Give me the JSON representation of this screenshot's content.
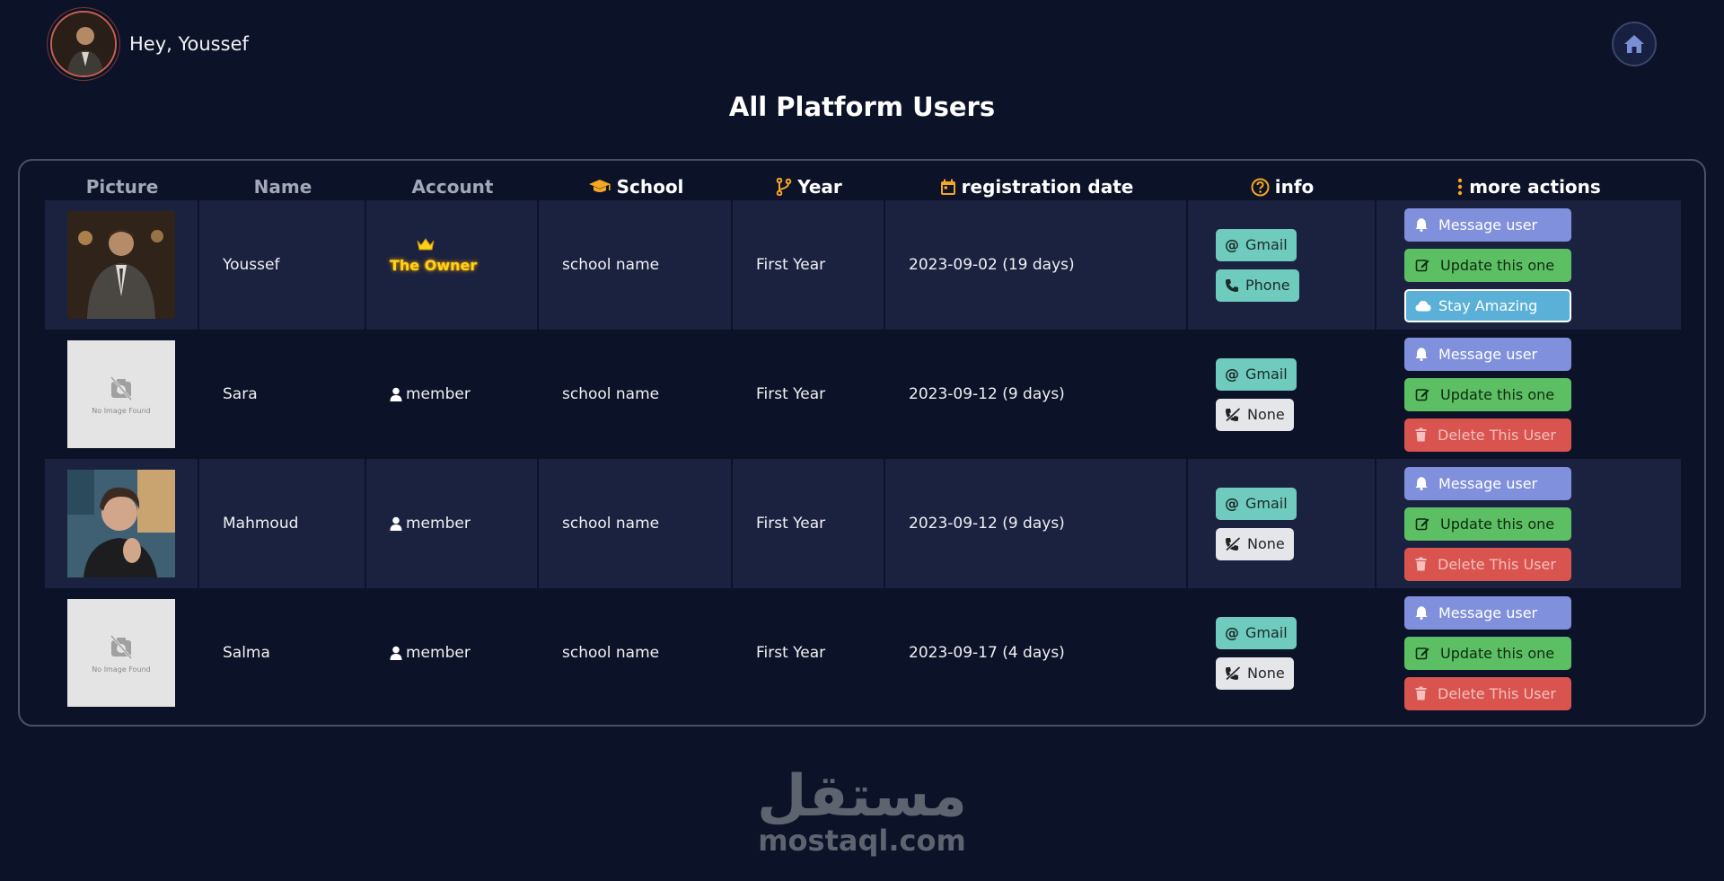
{
  "header": {
    "greeting": "Hey, Youssef",
    "page_title": "All Platform Users"
  },
  "columns": {
    "picture": "Picture",
    "name": "Name",
    "account": "Account",
    "school": "School",
    "year": "Year",
    "registration_date": "registration date",
    "info": "info",
    "more_actions": "more actions"
  },
  "no_image_text": "No Image Found",
  "users": [
    {
      "name": "Youssef",
      "account": "The Owner",
      "school": "school name",
      "year": "First Year",
      "registration": "2023-09-02 (19 days)",
      "contact1": "Gmail",
      "contact2": "Phone",
      "action1": "Message user",
      "action2": "Update this one",
      "action3": "Stay Amazing"
    },
    {
      "name": "Sara",
      "account": "member",
      "school": "school name",
      "year": "First Year",
      "registration": "2023-09-12 (9 days)",
      "contact1": "Gmail",
      "contact2": "None",
      "action1": "Message user",
      "action2": "Update this one",
      "action3": "Delete This User"
    },
    {
      "name": "Mahmoud",
      "account": "member",
      "school": "school name",
      "year": "First Year",
      "registration": "2023-09-12 (9 days)",
      "contact1": "Gmail",
      "contact2": "None",
      "action1": "Message user",
      "action2": "Update this one",
      "action3": "Delete This User"
    },
    {
      "name": "Salma",
      "account": "member",
      "school": "school name",
      "year": "First Year",
      "registration": "2023-09-17 (4 days)",
      "contact1": "Gmail",
      "contact2": "None",
      "action1": "Message user",
      "action2": "Update this one",
      "action3": "Delete This User"
    }
  ],
  "watermark": {
    "arabic": "مستقل",
    "latin": "mostaql.com"
  },
  "colors": {
    "background": "#0c1227",
    "row_alt": "#1b2240",
    "accent_orange": "#f5a623",
    "owner_gold": "#ffd21a",
    "message": "#8190dc",
    "update": "#5dbf64",
    "delete": "#d9534f",
    "amazing": "#5bb0d8",
    "contact": "#6fcbbd"
  }
}
